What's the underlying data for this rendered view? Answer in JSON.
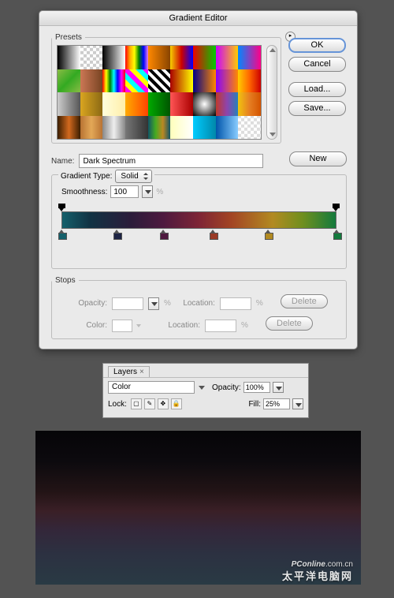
{
  "dialog": {
    "title": "Gradient Editor",
    "buttons": {
      "ok": "OK",
      "cancel": "Cancel",
      "load": "Load...",
      "save": "Save...",
      "new": "New",
      "delete": "Delete"
    },
    "presets_label": "Presets",
    "name_label": "Name:",
    "name_value": "Dark Spectrum",
    "type_label": "Gradient Type:",
    "type_value": "Solid",
    "smooth_label": "Smoothness:",
    "smooth_value": "100",
    "percent": "%",
    "stops_label": "Stops",
    "opacity_label": "Opacity:",
    "color_label": "Color:",
    "location_label": "Location:"
  },
  "gradient_stops": [
    {
      "pos": 0,
      "color": "#15606b"
    },
    {
      "pos": 20,
      "color": "#1d2444"
    },
    {
      "pos": 37,
      "color": "#4e1a3f"
    },
    {
      "pos": 55,
      "color": "#9a3b27"
    },
    {
      "pos": 75,
      "color": "#b28a21"
    },
    {
      "pos": 100,
      "color": "#137a3d"
    }
  ],
  "preset_swatches": [
    "linear-gradient(90deg,#000,#fff)",
    "repeating-conic-gradient(#ccc 0 25%,#fff 0 50%) 0/8px 8px",
    "linear-gradient(90deg,#000,#fff)",
    "linear-gradient(90deg,red,orange,yellow,green,blue,violet)",
    "linear-gradient(90deg,#f80,#840)",
    "linear-gradient(90deg,#f7d000,#c00,#00f)",
    "linear-gradient(90deg,#e00,#0c0)",
    "linear-gradient(90deg,#c0f,#fc0)",
    "linear-gradient(90deg,#08f,#f08)",
    "linear-gradient(135deg,#8b4,#3a2,#8b4)",
    "linear-gradient(90deg,#c75,#742)",
    "linear-gradient(90deg,red,yellow,green,cyan,blue,magenta,red)",
    "repeating-linear-gradient(45deg,#f0f 0 6px,#ff0 6px 12px,#0ff 12px 18px)",
    "repeating-linear-gradient(45deg,#fff 0 4px,#000 4px 8px)",
    "linear-gradient(90deg,#a00,#ff0)",
    "linear-gradient(90deg,#008,#f80)",
    "linear-gradient(90deg,#80f,#f80)",
    "linear-gradient(90deg,#fc0,#f60,#c00)",
    "linear-gradient(90deg,#ccc,#555)",
    "linear-gradient(90deg,#daa520,#8b6914)",
    "linear-gradient(90deg,#ffd,#fea)",
    "linear-gradient(90deg,#fa0,#f40)",
    "linear-gradient(90deg,#0a0,#050)",
    "linear-gradient(90deg,#f55,#a00)",
    "radial-gradient(#fff,#000)",
    "linear-gradient(90deg,#c0392b,#8e44ad,#2980b9)",
    "linear-gradient(90deg,#f1c40f,#e67e22,#d35400)",
    "linear-gradient(90deg,#3b1e00,#d2691e,#3b1e00)",
    "linear-gradient(90deg,#b87333,#e3a857,#b87333)",
    "linear-gradient(90deg,#888,#eee,#888)",
    "linear-gradient(90deg,#777,#333)",
    "linear-gradient(90deg,#156,#4a2,#b82,#156)",
    "linear-gradient(90deg,#ffb,#fff)",
    "linear-gradient(90deg,#0cf,#08a)",
    "linear-gradient(90deg,#05a,#8cf)",
    "repeating-conic-gradient(#ddd 0 25%,#fff 0 50%) 0/8px 8px"
  ],
  "layers": {
    "tab": "Layers",
    "mode": "Color",
    "opacity_label": "Opacity:",
    "opacity_value": "100%",
    "lock_label": "Lock:",
    "fill_label": "Fill:",
    "fill_value": "25%",
    "lock_icons": [
      "▢",
      "✎",
      "✥",
      "🔒"
    ]
  },
  "watermark": {
    "brand": "PConline",
    "suffix": ".com.cn",
    "cn": "太平洋电脑网"
  }
}
